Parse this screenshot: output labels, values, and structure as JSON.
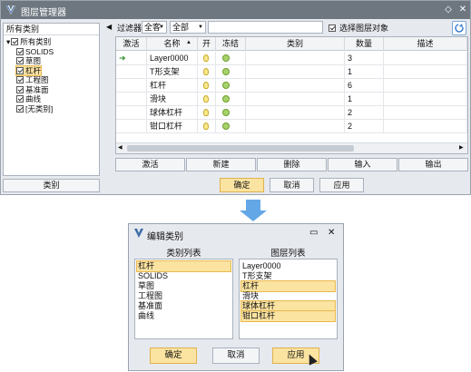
{
  "window": {
    "title": "图层管理器"
  },
  "tree": {
    "header": "所有类别",
    "items": [
      {
        "label": "所有类别",
        "level": 0
      },
      {
        "label": "SOLIDS",
        "level": 1
      },
      {
        "label": "草图",
        "level": 1
      },
      {
        "label": "杠杆",
        "level": 1,
        "selected": true
      },
      {
        "label": "工程图",
        "level": 1
      },
      {
        "label": "基准面",
        "level": 1
      },
      {
        "label": "曲线",
        "level": 1
      },
      {
        "label": "[无类别]",
        "level": 1
      }
    ],
    "category_button": "类别"
  },
  "filter": {
    "label": "过滤器",
    "scope_value": "全客",
    "type_value": "全部",
    "select_layer_objects": "选择图层对象"
  },
  "grid": {
    "columns": [
      "激活",
      "名称",
      "开",
      "冻结",
      "类别",
      "数量",
      "描述"
    ],
    "rows": [
      {
        "active": true,
        "name": "Layer0000",
        "count": "3"
      },
      {
        "active": false,
        "name": "T形支架",
        "count": "1"
      },
      {
        "active": false,
        "name": "杠杆",
        "count": "6"
      },
      {
        "active": false,
        "name": "滑块",
        "count": "1"
      },
      {
        "active": false,
        "name": "球体杠杆",
        "count": "2"
      },
      {
        "active": false,
        "name": "钳口杠杆",
        "count": "2"
      }
    ]
  },
  "actions": [
    "激活",
    "新建",
    "删除",
    "输入",
    "输出"
  ],
  "footer": {
    "ok": "确定",
    "cancel": "取消",
    "apply": "应用"
  },
  "dialog": {
    "title": "编辑类别",
    "category_list_title": "类别列表",
    "layer_list_title": "图层列表",
    "categories": [
      {
        "label": "杠杆",
        "selected": true
      },
      {
        "label": "SOLIDS",
        "selected": false
      },
      {
        "label": "草图",
        "selected": false
      },
      {
        "label": "工程图",
        "selected": false
      },
      {
        "label": "基准面",
        "selected": false
      },
      {
        "label": "曲线",
        "selected": false
      }
    ],
    "layers": [
      {
        "label": "Layer0000",
        "selected": false
      },
      {
        "label": "T形支架",
        "selected": false
      },
      {
        "label": "杠杆",
        "selected": true
      },
      {
        "label": "滑块",
        "selected": false
      },
      {
        "label": "球体杠杆",
        "selected": true
      },
      {
        "label": "钳口杠杆",
        "selected": true
      }
    ],
    "ok": "确定",
    "cancel": "取消",
    "apply": "应用"
  },
  "colors": {
    "selection": "#fbe3a1",
    "accent_arrow": "#63a7e6",
    "titlebar": "#6e7780"
  }
}
